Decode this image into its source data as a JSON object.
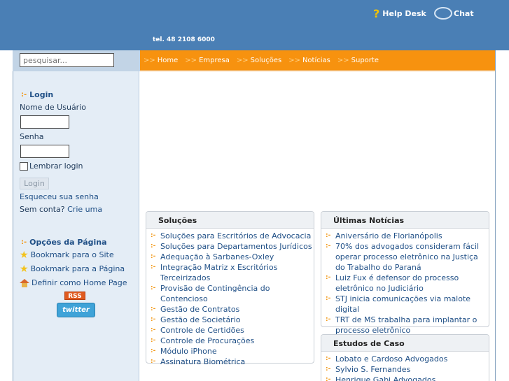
{
  "header": {
    "help_icon": "?",
    "help_label": "Help Desk",
    "chat_label": "Chat",
    "tel": "tel. 48 2108 6000"
  },
  "search": {
    "placeholder": "pesquisar..."
  },
  "nav": {
    "arrow": ">>",
    "items": [
      "Home",
      "Empresa",
      "Soluções",
      "Notícias",
      "Suporte"
    ]
  },
  "login": {
    "title": "Login",
    "bullet": ":-",
    "username_label": "Nome de Usuário",
    "password_label": "Senha",
    "remember_label": "Lembrar login",
    "button": "Login",
    "forgot": "Esqueceu sua senha",
    "no_account": "Sem conta?",
    "create": "Crie uma"
  },
  "options": {
    "title": "Opções da Página",
    "bookmark_site": "Bookmark para o Site",
    "bookmark_page": "Bookmark para a Página",
    "home_page": "Definir como Home Page",
    "rss": "RSS",
    "twitter": "twitter"
  },
  "solucoes": {
    "title": "Soluções",
    "items": [
      "Soluções para Escritórios de Advocacia",
      "Soluções para Departamentos Jurídicos",
      "Adequação à Sarbanes-Oxley",
      "Integração Matriz x Escritórios Terceirizados",
      "Provisão de Contingência do Contencioso",
      "Gestão de Contratos",
      "Gestão de Societário",
      "Controle de Certidões",
      "Controle de Procurações",
      "Módulo iPhone",
      "Assinatura Biométrica"
    ]
  },
  "noticias": {
    "title": "Últimas Notícias",
    "items": [
      "Aniversário de Florianópolis",
      "70% dos advogados consideram fácil operar processo eletrônico na Justiça do Trabalho do Paraná",
      "Luiz Fux é defensor do processo eletrônico no Judiciário",
      "STJ inicia comunicações via malote digital",
      "TRT de MS trabalha para implantar o processo eletrônico"
    ]
  },
  "casos": {
    "title": "Estudos de Caso",
    "items": [
      "Lobato e Cardoso Advogados",
      "Sylvio S. Fernandes",
      "Henrique Gabi Advogados"
    ]
  },
  "colors": {
    "header_bg": "#4a7fb5",
    "menu_bg": "#f7920f",
    "sidebar_bg": "#e4edf6"
  }
}
